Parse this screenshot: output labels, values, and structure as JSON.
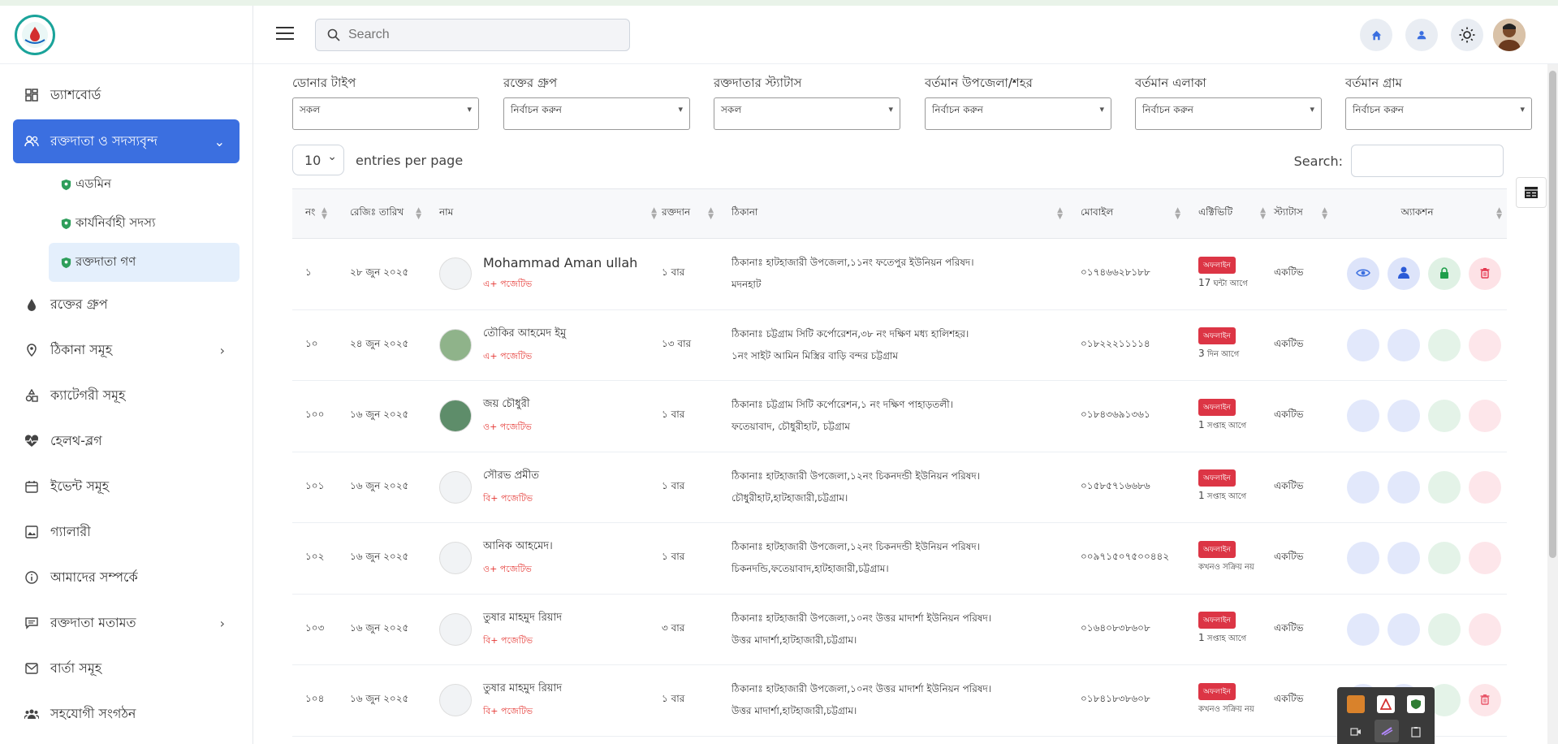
{
  "header": {
    "search_placeholder": "Search"
  },
  "sidebar": {
    "items": [
      {
        "label": "ড্যাশবোর্ড"
      },
      {
        "label": "রক্তদাতা ও সদস্যবৃন্দ"
      },
      {
        "label": "রক্তের গ্রুপ"
      },
      {
        "label": "ঠিকানা সমূহ"
      },
      {
        "label": "ক্যাটেগরী সমূহ"
      },
      {
        "label": "হেলথ-ব্লগ"
      },
      {
        "label": "ইভেন্ট সমূহ"
      },
      {
        "label": "গ্যালারী"
      },
      {
        "label": "আমাদের সম্পর্কে"
      },
      {
        "label": "রক্তদাতা মতামত"
      },
      {
        "label": "বার্তা সমূহ"
      },
      {
        "label": "সহযোগী সংগঠন"
      }
    ],
    "sub_items": [
      {
        "label": "এডমিন"
      },
      {
        "label": "কার্যনির্বাহী সদস্য"
      },
      {
        "label": "রক্তদাতা গণ"
      }
    ]
  },
  "filters": [
    {
      "label": "ডোনার টাইপ",
      "value": "সকল"
    },
    {
      "label": "রক্তের গ্রুপ",
      "value": "নির্বাচন করুন"
    },
    {
      "label": "রক্তদাতার স্ট্যাটাস",
      "value": "সকল"
    },
    {
      "label": "বর্তমান উপজেলা/শহর",
      "value": "নির্বাচন করুন"
    },
    {
      "label": "বর্তমান এলাকা",
      "value": "নির্বাচন করুন"
    },
    {
      "label": "বর্তমান গ্রাম",
      "value": "নির্বাচন করুন"
    }
  ],
  "table_controls": {
    "per_page": "10",
    "per_page_label": "entries per page",
    "search_label": "Search:"
  },
  "table": {
    "headers": [
      "নং",
      "রেজিঃ তারিখ",
      "নাম",
      "রক্তদান",
      "ঠিকানা",
      "মোবাইল",
      "এক্টিভিটি",
      "স্ট্যাটাস",
      "অ্যাকশন"
    ],
    "rows": [
      {
        "no": "১",
        "date": "২৮ জুন ২০২৫",
        "name": "Mohammad Aman ullah",
        "group": "এ+ পজেটিভ",
        "donations": "১ বার",
        "addr1": "ঠিকানাঃ হাটহাজারী উপজেলা,১১নং ফতেপুর ইউনিয়ন পরিষদ।",
        "addr2": "মদনহাট",
        "mobile": "০১৭৪৬৬২৮১৮৮",
        "badge": "অফলাইন",
        "ago_num": "17",
        "ago_text": "ঘন্টা আগে",
        "status": "একটিভ"
      },
      {
        "no": "১০",
        "date": "২৪ জুন ২০২৫",
        "name": "তৌকির আহমেদ ইমু",
        "group": "এ+ পজেটিভ",
        "donations": "১৩ বার",
        "addr1": "ঠিকানাঃ চট্টগ্রাম সিটি কর্পোরেশন,৩৮ নং দক্ষিণ মধ্য হালিশহর।",
        "addr2": "১নং সাইট আমিন মিস্ত্রির বাড়ি বন্দর চট্টগ্রাম",
        "mobile": "০১৮২২২১১১১৪",
        "badge": "অফলাইন",
        "ago_num": "3",
        "ago_text": "দিন আগে",
        "status": "একটিভ"
      },
      {
        "no": "১০০",
        "date": "১৬ জুন ২০২৫",
        "name": "জয় চৌধুরী",
        "group": "ও+ পজেটিভ",
        "donations": "১ বার",
        "addr1": "ঠিকানাঃ চট্টগ্রাম সিটি কর্পোরেশন,১ নং দক্ষিণ পাহাড়তলী।",
        "addr2": "ফতেয়াবাদ, চৌধুরীহাট, চট্টগ্রাম",
        "mobile": "০১৮৪৩৬৯১৩৬১",
        "badge": "অফলাইন",
        "ago_num": "1",
        "ago_text": "সপ্তাহ আগে",
        "status": "একটিভ"
      },
      {
        "no": "১০১",
        "date": "১৬ জুন ২০২৫",
        "name": "সৌরভ প্রমীত",
        "group": "বি+ পজেটিভ",
        "donations": "১ বার",
        "addr1": "ঠিকানাঃ হাটহাজারী উপজেলা,১২নং চিকনদন্ডী ইউনিয়ন পরিষদ।",
        "addr2": "চৌধুরীহাট,হাটহাজারী,চট্টগ্রাম।",
        "mobile": "০১৫৮৫৭১৬৬৮৬",
        "badge": "অফলাইন",
        "ago_num": "1",
        "ago_text": "সপ্তাহ আগে",
        "status": "একটিভ"
      },
      {
        "no": "১০২",
        "date": "১৬ জুন ২০২৫",
        "name": "আনিক আহমেদ।",
        "group": "ও+ পজেটিভ",
        "donations": "১ বার",
        "addr1": "ঠিকানাঃ হাটহাজারী উপজেলা,১২নং চিকনদন্ডী ইউনিয়ন পরিষদ।",
        "addr2": "চিকনদন্ডি,ফতেয়াবাদ,হাটহাজারী,চট্টগ্রাম।",
        "mobile": "০০৯৭১৫০৭৫০০৪৪২",
        "badge": "অফলাইন",
        "ago_num": "",
        "ago_text": "কখনও সক্রিয় নয়",
        "status": "একটিভ"
      },
      {
        "no": "১০৩",
        "date": "১৬ জুন ২০২৫",
        "name": "তুষার মাহমুদ রিয়াদ",
        "group": "বি+ পজেটিভ",
        "donations": "৩ বার",
        "addr1": "ঠিকানাঃ হাটহাজারী উপজেলা,১০নং উত্তর মাদার্শা ইউনিয়ন পরিষদ।",
        "addr2": "উত্তর মাদার্শা,হাটহাজারী,চট্টগ্রাম।",
        "mobile": "০১৬৪০৮৩৮৬০৮",
        "badge": "অফলাইন",
        "ago_num": "1",
        "ago_text": "সপ্তাহ আগে",
        "status": "একটিভ"
      },
      {
        "no": "১০৪",
        "date": "১৬ জুন ২০২৫",
        "name": "তুষার মাহমুদ রিয়াদ",
        "group": "বি+ পজেটিভ",
        "donations": "১ বার",
        "addr1": "ঠিকানাঃ হাটহাজারী উপজেলা,১০নং উত্তর মাদার্শা ইউনিয়ন পরিষদ।",
        "addr2": "উত্তর মাদার্শা,হাটহাজারী,চট্টগ্রাম।",
        "mobile": "০১৮৪১৮৩৮৬০৮",
        "badge": "অফলাইন",
        "ago_num": "",
        "ago_text": "কখনও সক্রিয় নয়",
        "status": "একটিভ"
      }
    ]
  },
  "colors": {
    "accent": "#3b6fe0",
    "offline_badge": "#dc3545",
    "group_text": "#e53935"
  }
}
